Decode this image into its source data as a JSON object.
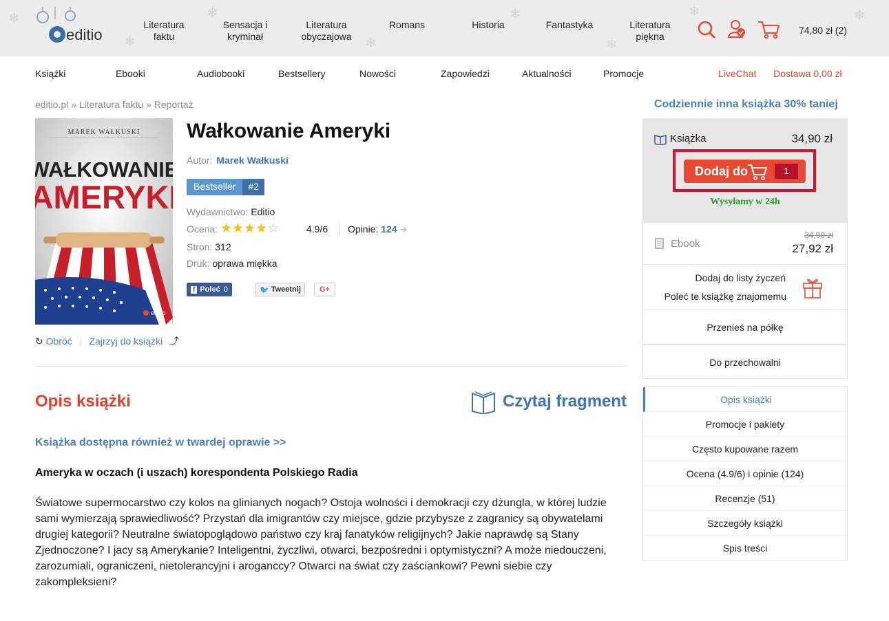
{
  "header": {
    "logo_text": "editio",
    "categories": [
      "Literatura\nfaktu",
      "Sensacja i\nkryminał",
      "Literatura\nobyczajowa",
      "Romans",
      "Historia",
      "Fantastyka",
      "Literatura\npiękna"
    ],
    "cart_summary": "74,80 zł (2)"
  },
  "menu": {
    "items": [
      "Książki",
      "Ebooki",
      "Audiobooki",
      "Bestsellery",
      "Nowości",
      "Zapowiedzi",
      "Aktualności",
      "Promocje"
    ],
    "livechat": "LiveChat",
    "shipping": "Dostawa 0,00 zł"
  },
  "breadcrumb": "editio.pl » Literatura faktu » Reportaż",
  "book": {
    "cover_author": "MAREK WAŁKUSKI",
    "cover_title_1": "WAŁKOWANIE",
    "cover_title_2": "AMERYKI",
    "cover_publisher": "editio",
    "title": "Wałkowanie Ameryki",
    "author_label": "Autor:",
    "author": "Marek Wałkuski",
    "badge_label": "Bestseller",
    "badge_rank": "#2",
    "publisher_label": "Wydawnictwo:",
    "publisher": "Editio",
    "rating_label": "Ocena:",
    "rating": "4.9/6",
    "stars_filled": 4,
    "opinions_label": "Opinie:",
    "opinions": "124",
    "pages_label": "Stron:",
    "pages": "312",
    "binding_label": "Druk:",
    "binding": "oprawa miękka",
    "turn": "Obróć",
    "look_inside": "Zajrzyj do książki"
  },
  "share": {
    "fb": "Poleć",
    "fb_count": "0",
    "tweet": "Tweetnij",
    "gplus": "G+"
  },
  "description": {
    "heading": "Opis książki",
    "read_fragment": "Czytaj fragment",
    "also_available": "Książka dostępna również w twardej oprawie >>",
    "lead": "Ameryka w oczach (i uszach) korespondenta Polskiego Radia",
    "body": "Światowe supermocarstwo czy kolos na glinianych nogach? Ostoja wolności i demokracji czy dżungla, w której ludzie sami wymierzają sprawiedliwość? Przystań dla imigrantów czy miejsce, gdzie przybysze z zagranicy są obywatelami drugiej kategorii? Neutralne światopoglądowo państwo czy kraj fanatyków religijnych? Jakie naprawdę są Stany Zjednoczone? I jacy są Amerykanie? Inteligentni, życzliwi, otwarci, bezpośredni i optymistyczni? A może niedouczeni, zarozumiali, ograniczeni, nietolerancyjni i aroganccy? Otwarci na świat czy zaściankowi? Pewni siebie czy zakompleksieni?"
  },
  "sidebar": {
    "daily_promo": "Codziennie inna książka 30% taniej",
    "book_label": "Książka",
    "book_price": "34,90 zł",
    "add_button": "Dodaj do",
    "add_qty": "1",
    "shipping_note": "Wysyłamy w 24h",
    "ebook_label": "Ebook",
    "ebook_old_price": "34,90 zł",
    "ebook_price": "27,92 zł",
    "wishlist": "Dodaj do listy życzeń",
    "recommend": "Poleć te książkę znajomemu",
    "move_shelf": "Przenieś na półkę",
    "storage": "Do przechowalni",
    "nav": [
      "Opis książki",
      "Promocje i pakiety",
      "Często kupowane razem",
      "Ocena (4.9/6) i opinie (124)",
      "Recenzje (51)",
      "Szczegóły książki",
      "Spis treści"
    ]
  }
}
